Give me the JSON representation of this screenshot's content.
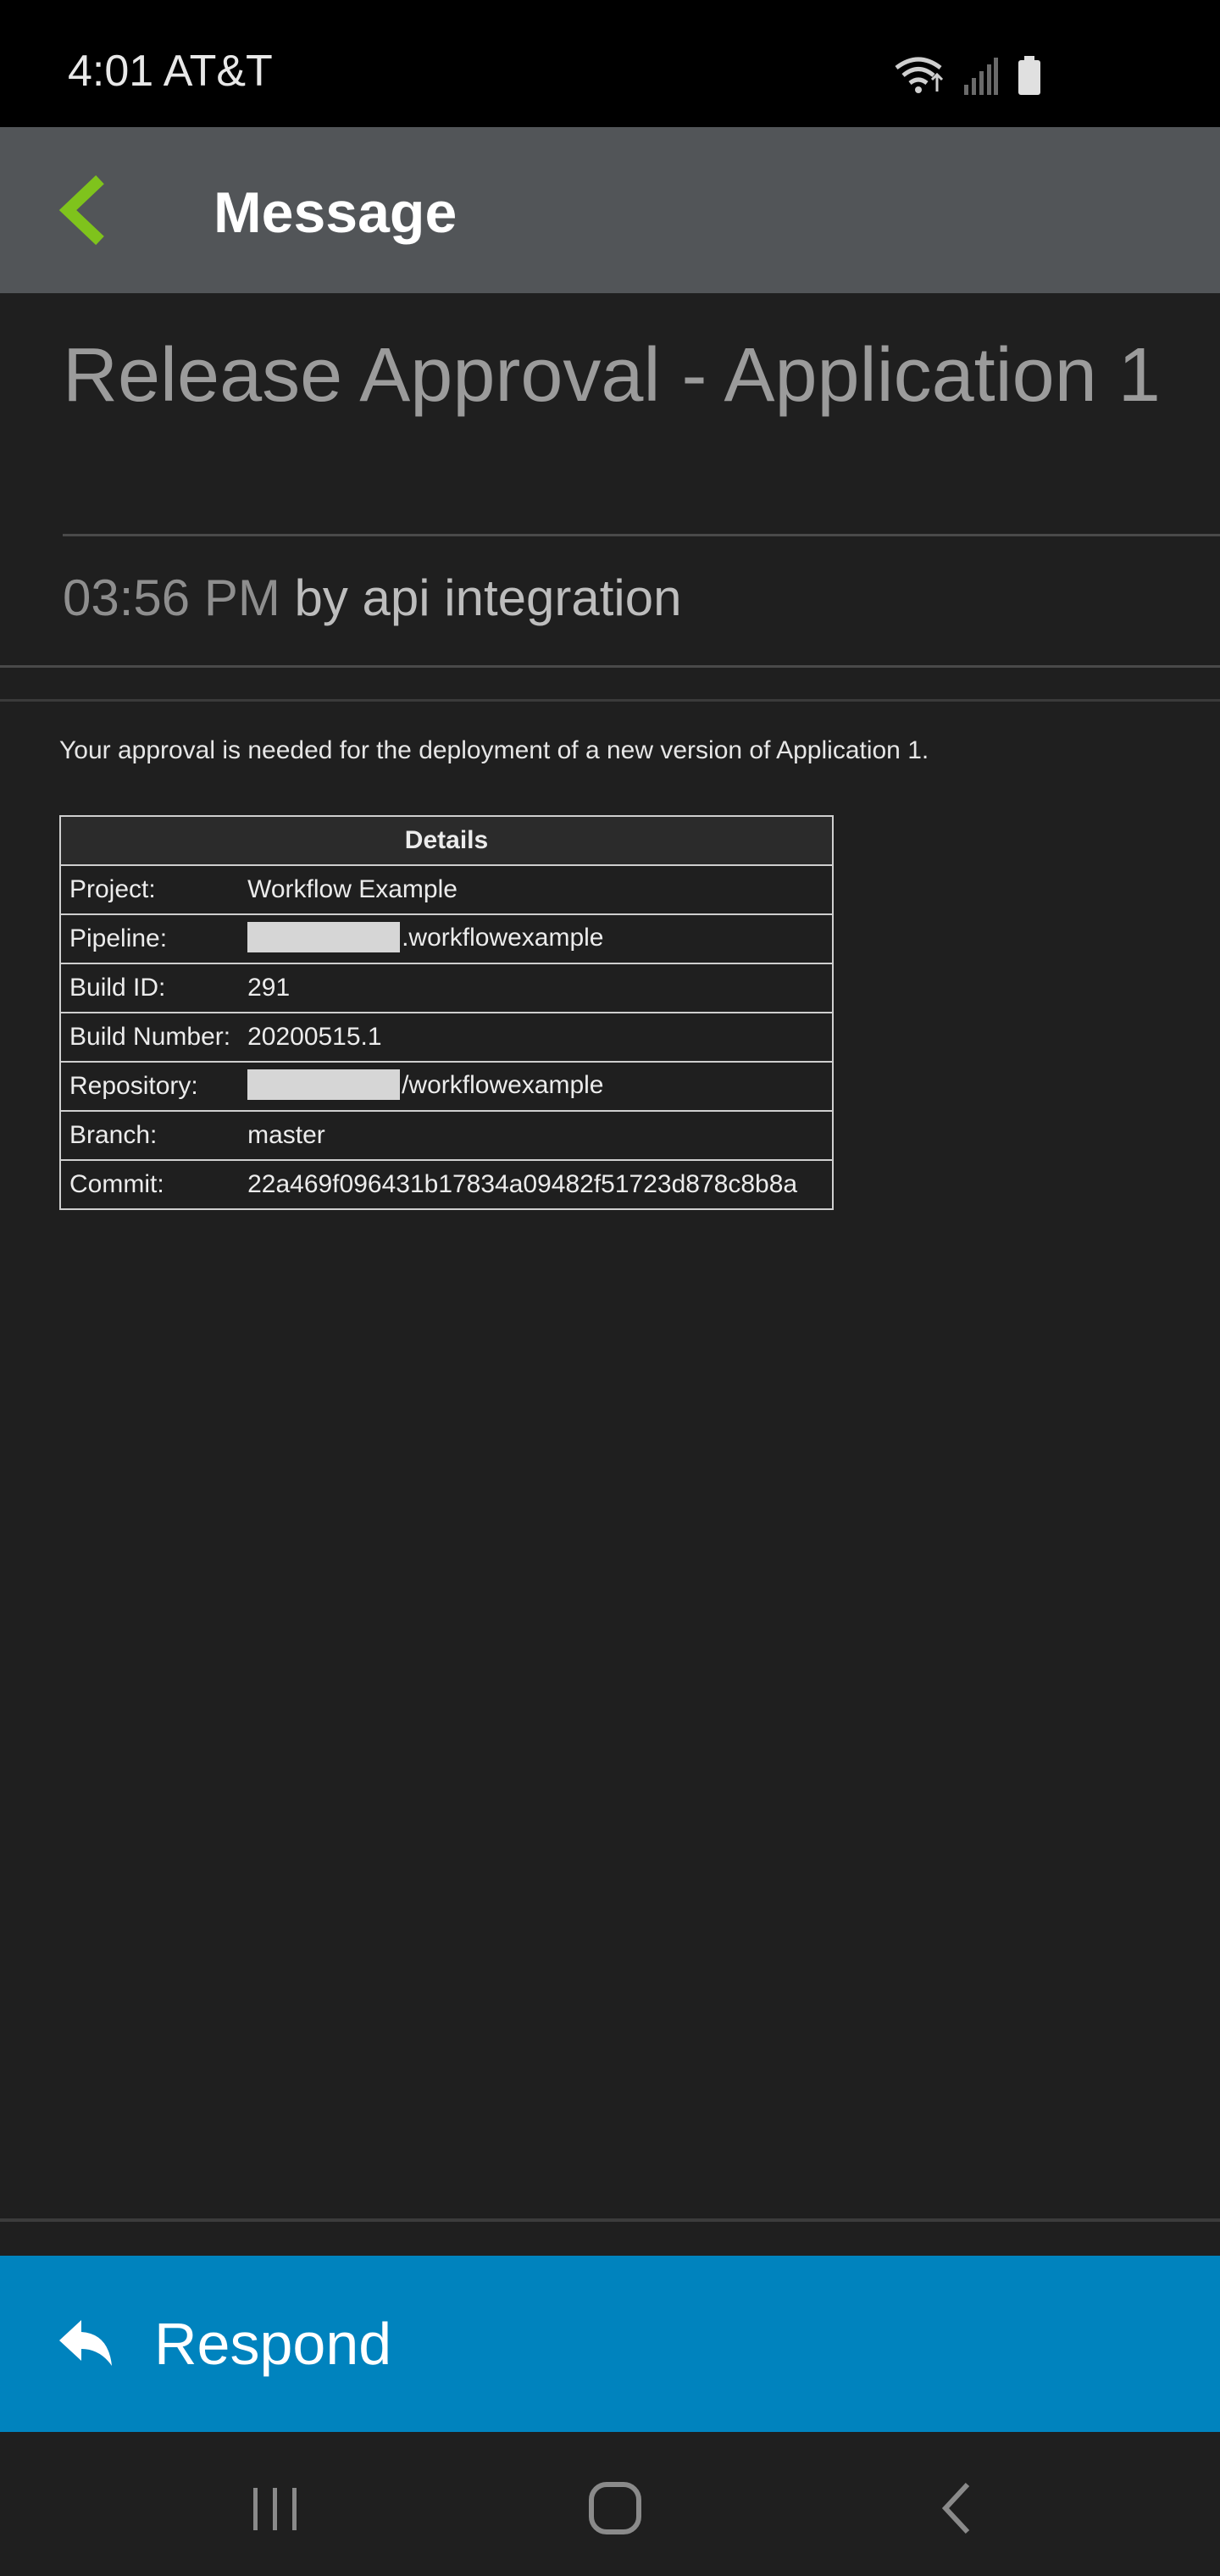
{
  "status_bar": {
    "time_carrier": "4:01 AT&T"
  },
  "header": {
    "title": "Message",
    "back_icon": "chevron-left-icon",
    "accent_color": "#7fc31c"
  },
  "message": {
    "subject": "Release Approval - Application 1",
    "time": "03:56 PM",
    "author_text": "by api integration",
    "body": "Your approval is needed for the deployment of a new version of Application 1."
  },
  "details": {
    "heading": "Details",
    "rows": [
      {
        "label": "Project:",
        "value": "Workflow Example"
      },
      {
        "label": "Pipeline:",
        "value": ".workflowexample",
        "redacted": true
      },
      {
        "label": "Build ID:",
        "value": "291"
      },
      {
        "label": "Build Number:",
        "value": "20200515.1"
      },
      {
        "label": "Repository:",
        "value": "/workflowexample",
        "redacted": true
      },
      {
        "label": "Branch:",
        "value": "master"
      },
      {
        "label": "Commit:",
        "value": "22a469f096431b17834a09482f51723d878c8b8a"
      }
    ]
  },
  "respond": {
    "label": "Respond",
    "icon": "reply-icon",
    "color": "#0083be"
  },
  "nav": {
    "recents_icon": "recent-apps-icon",
    "home_icon": "home-icon",
    "back_icon": "back-icon"
  }
}
